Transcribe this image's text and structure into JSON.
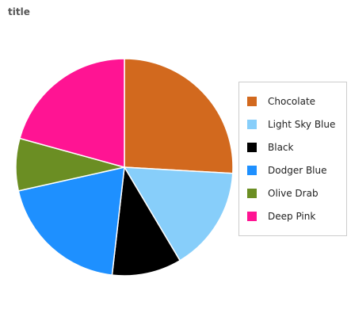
{
  "chart_data": {
    "type": "pie",
    "title": "title",
    "categories": [
      "Chocolate",
      "Light Sky Blue",
      "Black",
      "Dodger Blue",
      "Olive Drab",
      "Deep Pink"
    ],
    "values": [
      25,
      15,
      10,
      19,
      7.5,
      20
    ],
    "colors": [
      "#d2691e",
      "#87cefa",
      "#000000",
      "#1e90ff",
      "#6b8e23",
      "#ff1493"
    ],
    "legend_position": "right"
  }
}
